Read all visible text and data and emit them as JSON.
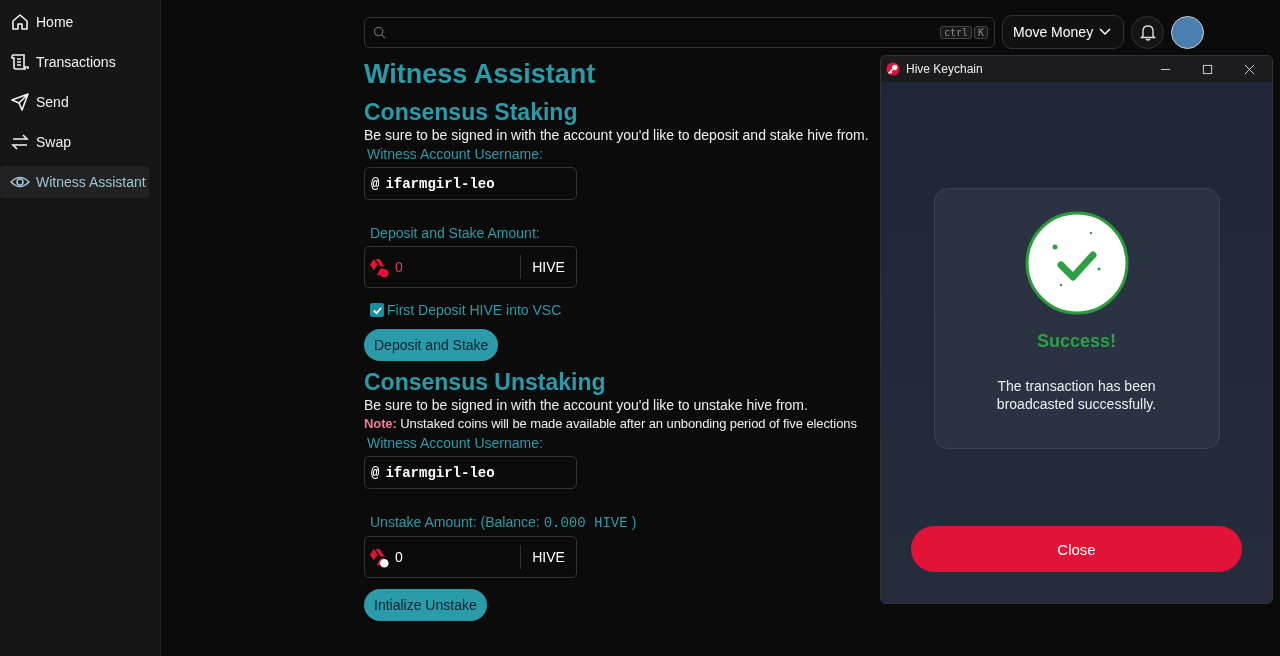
{
  "sidebar": {
    "items": [
      {
        "label": "Home",
        "selected": false
      },
      {
        "label": "Transactions",
        "selected": false
      },
      {
        "label": "Send",
        "selected": false
      },
      {
        "label": "Swap",
        "selected": false
      },
      {
        "label": "Witness Assistant",
        "selected": true
      }
    ]
  },
  "topbar": {
    "shortcut_keys": [
      "ctrl",
      "K"
    ],
    "menu_button": "Move Money"
  },
  "page_title": "Witness Assistant",
  "sections": [
    {
      "title": "Consensus Staking",
      "description": "Be sure to be signed in with the account you'd like to deposit and stake hive from.",
      "username_label": "Witness Account Username:",
      "username_prefix": "@",
      "username": "ifarmgirl-leo",
      "amount_label": "Deposit and Stake Amount:",
      "amount": "0",
      "amount_error": true,
      "currency": "HIVE",
      "checkbox": {
        "label": "First Deposit HIVE into VSC",
        "checked": true
      },
      "button": "Deposit and Stake"
    },
    {
      "title": "Consensus Unstaking",
      "description": "Be sure to be signed in with the account you'd like to unstake hive from.",
      "note_label": "Note:",
      "note_text": "Unstaked coins will be made available after an unbonding period of five elections",
      "username_label": "Witness Account Username:",
      "username_prefix": "@",
      "username": "ifarmgirl-leo",
      "amount_label": "Unstake Amount: (Balance:",
      "balance": "0.000 HIVE",
      "amount_label_end": ")",
      "amount": "0",
      "amount_error": false,
      "currency": "HIVE",
      "button": "Intialize Unstake"
    }
  ],
  "popup": {
    "title": "Hive Keychain",
    "status": "Success!",
    "message": "The transaction has been broadcasted successfully.",
    "button": "Close"
  }
}
